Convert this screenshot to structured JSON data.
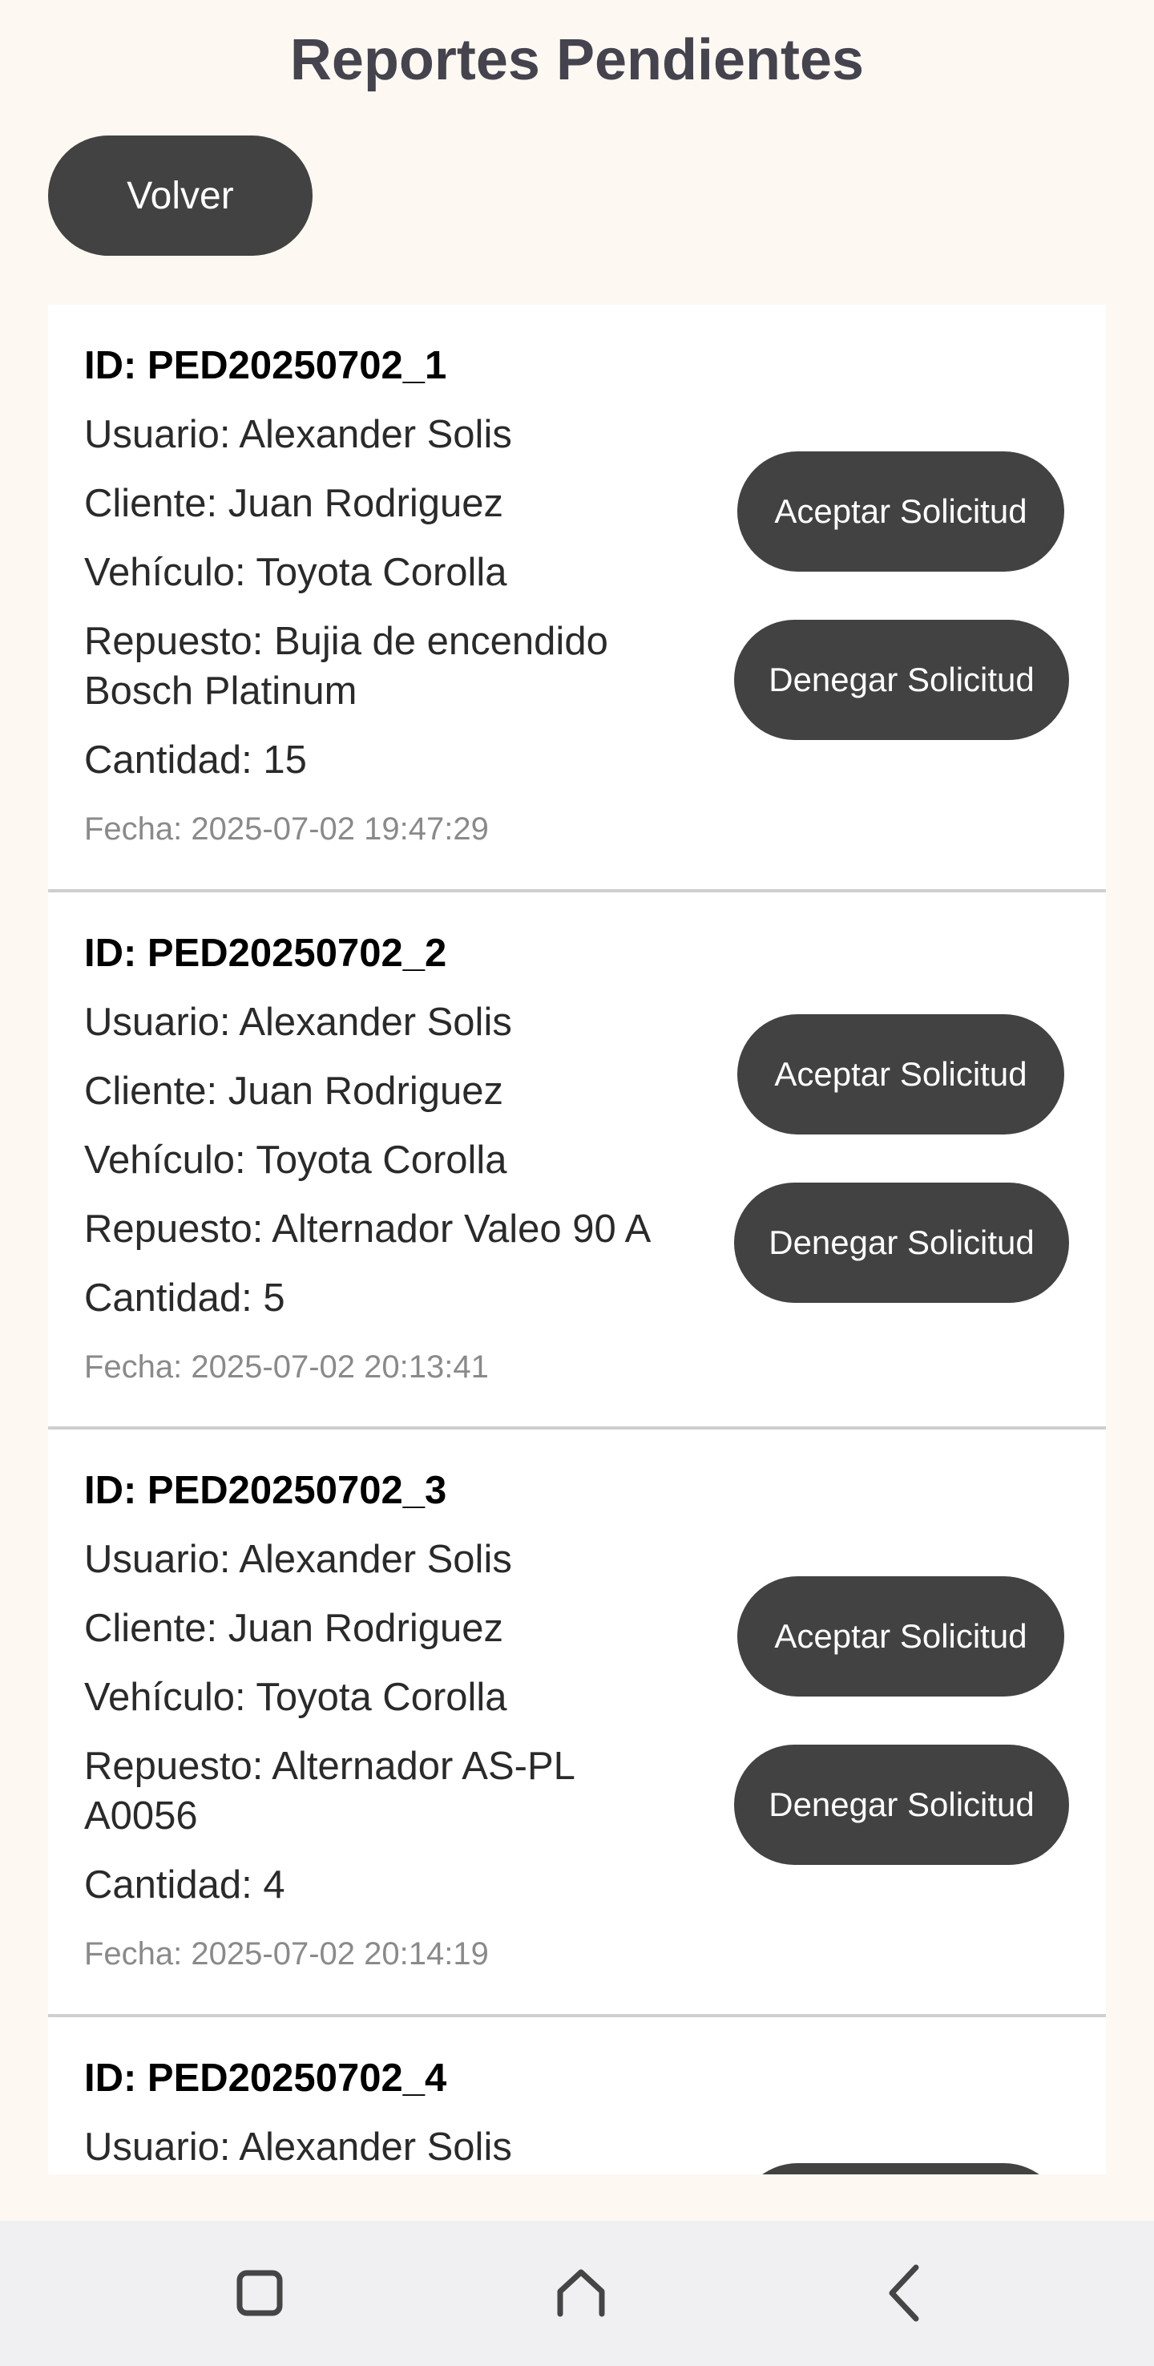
{
  "header": {
    "title": "Reportes Pendientes",
    "back_label": "Volver"
  },
  "requests": [
    {
      "id": "ID: PED20250702_1",
      "usuario": "Usuario: Alexander Solis",
      "cliente": "Cliente: Juan Rodriguez",
      "vehiculo": "Vehículo: Toyota Corolla",
      "repuesto_line1": "Repuesto: Bujia de encendido",
      "repuesto_line2": "Bosch Platinum",
      "cantidad": "Cantidad: 15",
      "fecha": "Fecha: 2025-07-02 19:47:29",
      "accept_label": "Aceptar Solicitud",
      "deny_label": "Denegar Solicitud"
    },
    {
      "id": "ID: PED20250702_2",
      "usuario": "Usuario: Alexander Solis",
      "cliente": "Cliente: Juan Rodriguez",
      "vehiculo": "Vehículo: Toyota Corolla",
      "repuesto_line1": "Repuesto: Alternador Valeo 90 A",
      "cantidad": "Cantidad: 5",
      "fecha": "Fecha: 2025-07-02 20:13:41",
      "accept_label": "Aceptar Solicitud",
      "deny_label": "Denegar Solicitud"
    },
    {
      "id": "ID: PED20250702_3",
      "usuario": "Usuario: Alexander Solis",
      "cliente": "Cliente: Juan Rodriguez",
      "vehiculo": "Vehículo: Toyota Corolla",
      "repuesto_line1": "Repuesto: Alternador AS-PL",
      "repuesto_line2": "A0056",
      "cantidad": "Cantidad: 4",
      "fecha": "Fecha: 2025-07-02 20:14:19",
      "accept_label": "Aceptar Solicitud",
      "deny_label": "Denegar Solicitud"
    },
    {
      "id": "ID: PED20250702_4",
      "usuario": "Usuario: Alexander Solis"
    }
  ],
  "navbar": {
    "recents_icon": "square-icon",
    "home_icon": "home-icon",
    "back_icon": "chevron-left-icon"
  },
  "colors": {
    "background": "#fdf8f2",
    "button": "#424242",
    "title": "#45434d",
    "date_text": "#8a8a8a"
  }
}
